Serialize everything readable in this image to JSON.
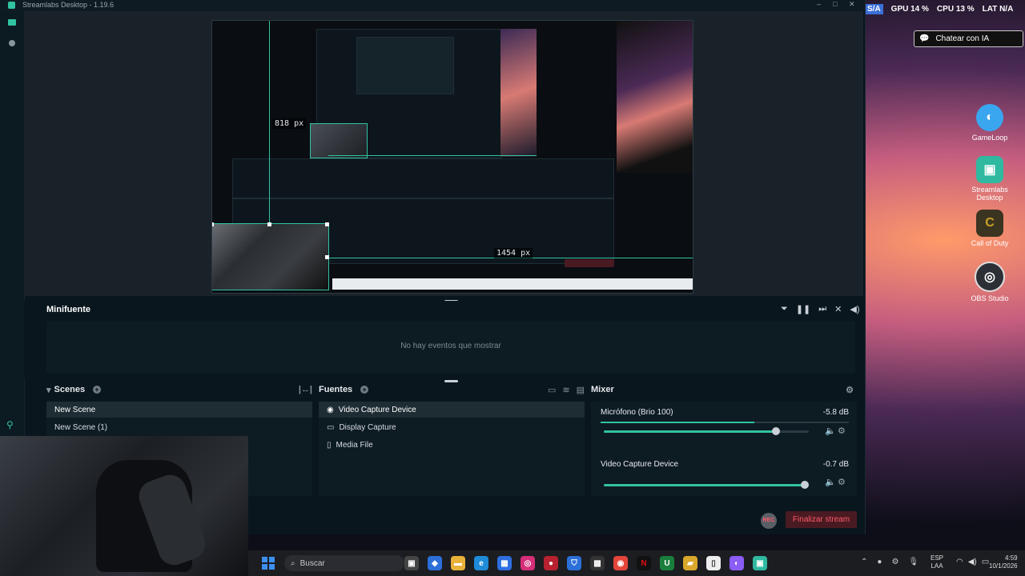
{
  "window": {
    "title": "Streamlabs Desktop - 1.19.6"
  },
  "preview": {
    "width_label": "1454 px",
    "height_label": "818 px"
  },
  "minifuente": {
    "title": "Minifuente",
    "empty_text": "No hay eventos que mostrar"
  },
  "scenes": {
    "title": "Scenes",
    "items": [
      "New Scene",
      "New Scene (1)"
    ]
  },
  "fuentes": {
    "title": "Fuentes",
    "items": [
      {
        "label": "Video Capture Device",
        "icon": "camera-icon"
      },
      {
        "label": "Display Capture",
        "icon": "monitor-icon"
      },
      {
        "label": "Media File",
        "icon": "file-icon"
      }
    ]
  },
  "mixer": {
    "title": "Mixer",
    "channels": [
      {
        "name": "Micrófono (Brio 100)",
        "db": "-5.8 dB",
        "volume": 0.84
      },
      {
        "name": "Video Capture Device",
        "db": "-0.7 dB",
        "volume": 0.98
      }
    ]
  },
  "footer": {
    "rec_label": "REC",
    "end_stream": "Finalizar stream"
  },
  "overlay": {
    "badge": "S/A",
    "gpu": "GPU 14 %",
    "cpu": "CPU 13 %",
    "lat": "LAT N/A",
    "chat_button": "Chatear con IA"
  },
  "desktop_icons": [
    {
      "label": "GameLoop",
      "color": "#3aa6f0"
    },
    {
      "label": "Streamlabs Desktop",
      "color": "#2fb9a0"
    },
    {
      "label": "Call of Duty",
      "color": "#c9a227"
    },
    {
      "label": "OBS Studio",
      "color": "#2c2f36"
    }
  ],
  "taskbar": {
    "search_placeholder": "Buscar",
    "lang": "ESP",
    "lang2": "LAA",
    "time": "4:59",
    "date": "10/1/2026"
  },
  "colors": {
    "accent": "#31c3a2",
    "end_stream_bg": "#4a1a22",
    "end_stream_text": "#ff5a6a"
  }
}
